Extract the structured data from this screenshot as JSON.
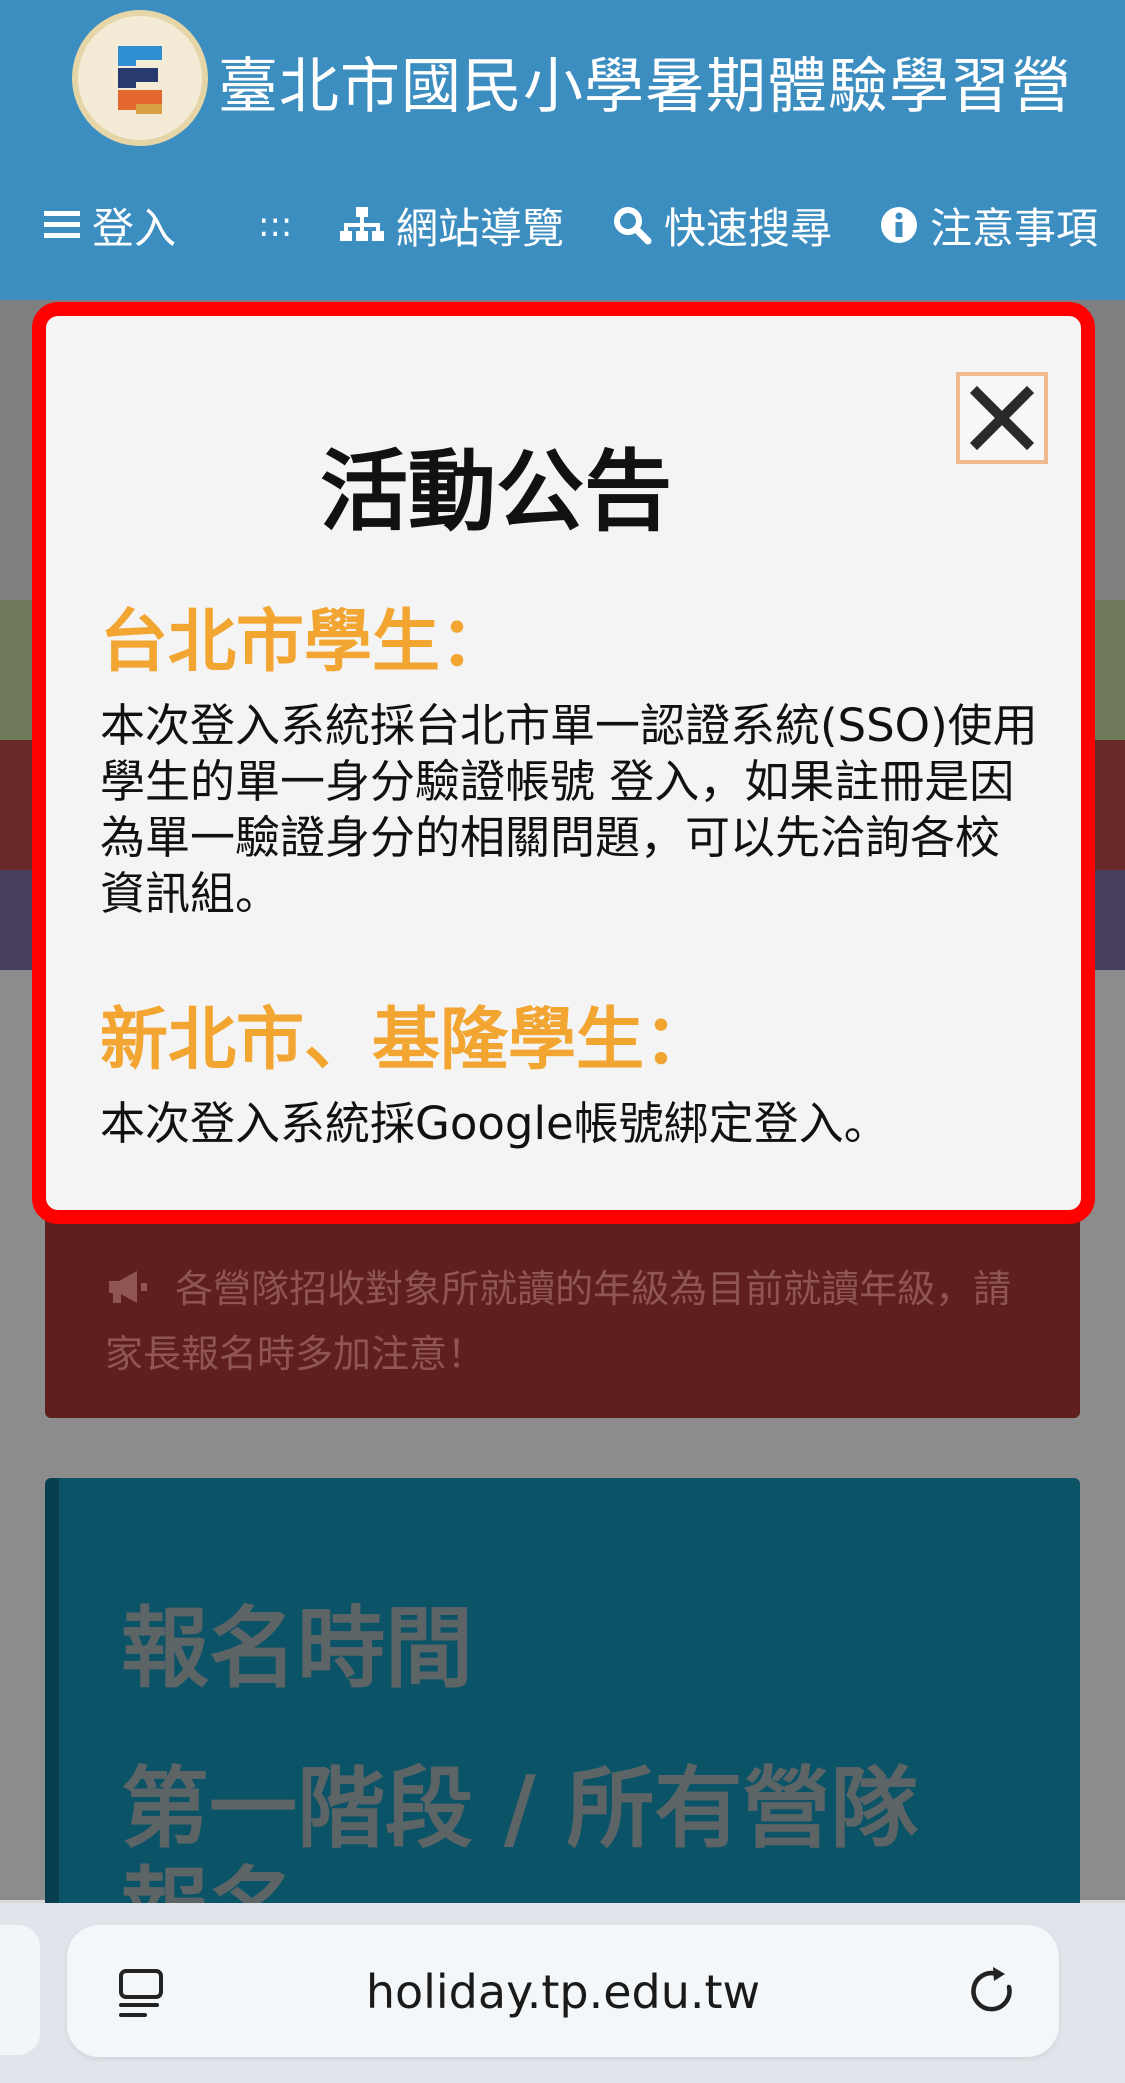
{
  "header": {
    "site_title": "臺北市國民小學暑期體驗學習營",
    "nav": {
      "login": "登入",
      "accesskey": ":::",
      "sitemap": "網站導覽",
      "search": "快速搜尋",
      "notice": "注意事項"
    }
  },
  "modal": {
    "title": "活動公告",
    "taipei_heading": "台北市學生：",
    "taipei_body": "本次登入系統採台北市單一認證系統(SSO)使用 學生的單一身分驗證帳號 登入，如果註冊是因為單一驗證身分的相關問題，可以先洽詢各校資訊組。",
    "newtaipei_heading": "新北市、基隆學生：",
    "newtaipei_body": "本次登入系統採Google帳號綁定登入。"
  },
  "background": {
    "notice_text": "各營隊招收對象所就讀的年級為目前就讀年級，請家長報名時多加注意！",
    "signup_title": "報名時間",
    "signup_subtitle_line1": "第一階段 / 所有營隊",
    "signup_subtitle_line2": "報名"
  },
  "browser": {
    "url": "holiday.tp.edu.tw"
  },
  "colors": {
    "header_bg": "#3d8ec0",
    "modal_border": "#ff0000",
    "section_heading": "#f2a530"
  }
}
